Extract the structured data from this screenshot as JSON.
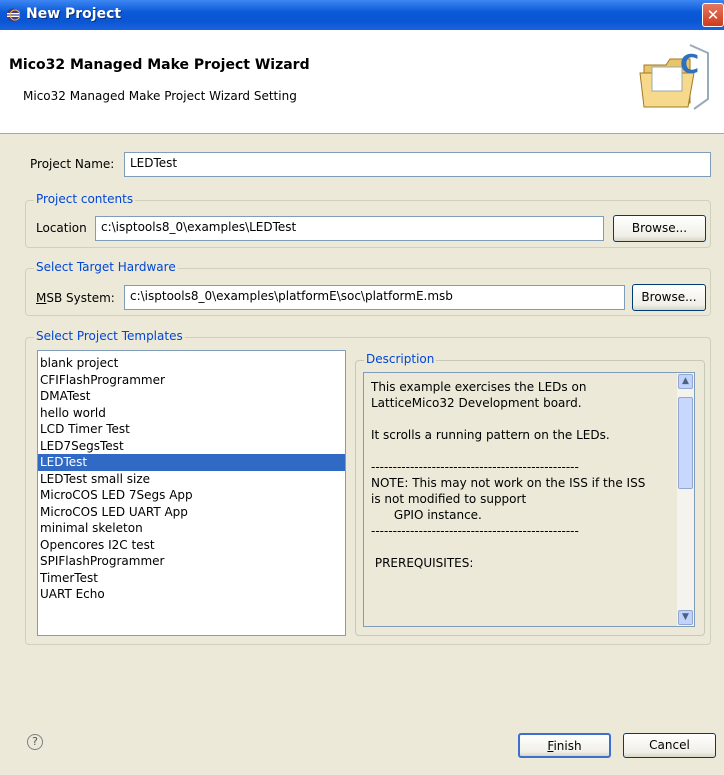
{
  "window": {
    "title": "New Project"
  },
  "banner": {
    "title": "Mico32 Managed Make Project Wizard",
    "subtitle": "Mico32 Managed Make Project Wizard Setting"
  },
  "project_name": {
    "label": "Project Name:",
    "value": "LEDTest"
  },
  "project_contents": {
    "group_title": "Project contents",
    "location_label": "Location",
    "location_value": "c:\\isptools8_0\\examples\\LEDTest",
    "browse_label": "Browse..."
  },
  "target_hardware": {
    "group_title": "Select Target Hardware",
    "msb_label_u": "M",
    "msb_label_rest": "SB System:",
    "msb_value": "c:\\isptools8_0\\examples\\platformE\\soc\\platformE.msb",
    "browse_label": "Browse..."
  },
  "templates": {
    "group_title": "Select Project Templates",
    "items": [
      "blank project",
      "CFIFlashProgrammer",
      "DMATest",
      "hello world",
      "LCD Timer Test",
      "LED7SegsTest",
      "LEDTest",
      "LEDTest small size",
      "MicroCOS LED 7Segs App",
      "MicroCOS LED UART App",
      "minimal skeleton",
      "Opencores I2C test",
      "SPIFlashProgrammer",
      "TimerTest",
      "UART Echo"
    ],
    "selected": "LEDTest"
  },
  "description": {
    "group_title": "Description",
    "text": "This example exercises the LEDs on\nLatticeMico32 Development board.\n\nIt scrolls a running pattern on the LEDs.\n\n------------------------------------------------\nNOTE: This may not work on the ISS if the ISS\nis not modified to support\n      GPIO instance.\n------------------------------------------------\n\n PREREQUISITES:"
  },
  "footer": {
    "finish_u": "F",
    "finish_rest": "inish",
    "cancel_label": "Cancel",
    "help_glyph": "?"
  },
  "colors": {
    "title_bar": "#0b5ad9",
    "group_title": "#0046d5",
    "selection": "#316ac5",
    "dialog_bg": "#ece9d8"
  }
}
